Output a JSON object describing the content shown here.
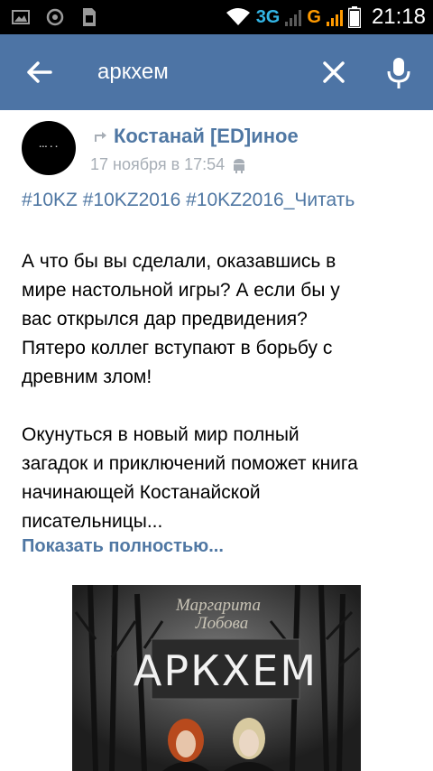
{
  "status_bar": {
    "network_3g": "3G",
    "network_g": "G",
    "time": "21:18"
  },
  "search": {
    "query": "аркхем"
  },
  "post": {
    "avatar_icon": "group-avatar",
    "author": "Костанай [ED]иное",
    "date": "17 ноября в 17:54",
    "hashtags": "#10KZ #10KZ2016 #10KZ2016_Читать",
    "paragraph1_lines": [
      "А что бы вы сделали, оказавшись в",
      "мире настольной игры? А если бы у",
      "вас открылся дар предвидения?",
      "Пятеро коллег вступают в борьбу с",
      "древним злом!"
    ],
    "paragraph2_lines": [
      "Окунуться в новый мир полный",
      "загадок и приключений поможет книга",
      "начинающей Костанайской",
      "писательницы..."
    ],
    "show_more": "Показать полностью..."
  },
  "book_cover": {
    "author_first": "Маргарита",
    "author_last": "Лобова",
    "title": "АРКХЕМ"
  },
  "colors": {
    "toolbar": "#4d74a5",
    "link": "#4f77a3",
    "date": "#a7aeb6"
  }
}
